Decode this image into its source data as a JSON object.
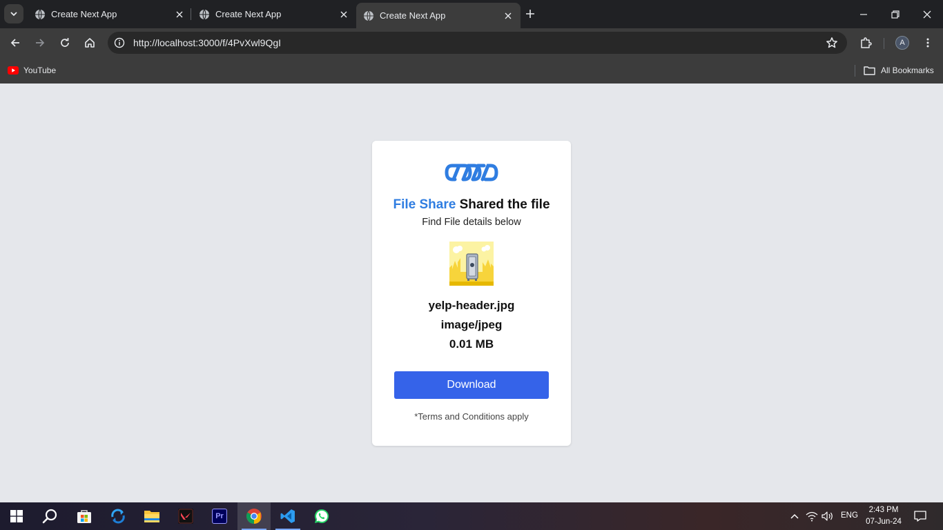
{
  "browser": {
    "tabs": [
      {
        "title": "Create Next App",
        "active": false
      },
      {
        "title": "Create Next App",
        "active": false
      },
      {
        "title": "Create Next App",
        "active": true
      }
    ],
    "url": "http://localhost:3000/f/4PvXwl9QgI",
    "bookmarks": [
      {
        "label": "YouTube",
        "icon": "youtube-icon"
      }
    ],
    "all_bookmarks_label": "All Bookmarks",
    "profile_initial": "A"
  },
  "page": {
    "brand": "File Share",
    "headline_rest": "Shared the file",
    "subtitle": "Find File details below",
    "file": {
      "name": "yelp-header.jpg",
      "type": "image/jpeg",
      "size": "0.01 MB"
    },
    "download_label": "Download",
    "terms": "*Terms and Conditions apply",
    "colors": {
      "brand": "#2f7de1",
      "button": "#3563e9",
      "background": "#e5e7eb"
    }
  },
  "taskbar": {
    "apps": [
      "start-icon",
      "search-icon",
      "microsoft-store-icon",
      "sync-app-icon",
      "file-explorer-icon",
      "valorant-icon",
      "premiere-pro-icon",
      "chrome-icon",
      "vscode-icon",
      "whatsapp-icon"
    ],
    "premiere_label": "Pr",
    "language": "ENG",
    "time": "2:43 PM",
    "date": "07-Jun-24"
  }
}
